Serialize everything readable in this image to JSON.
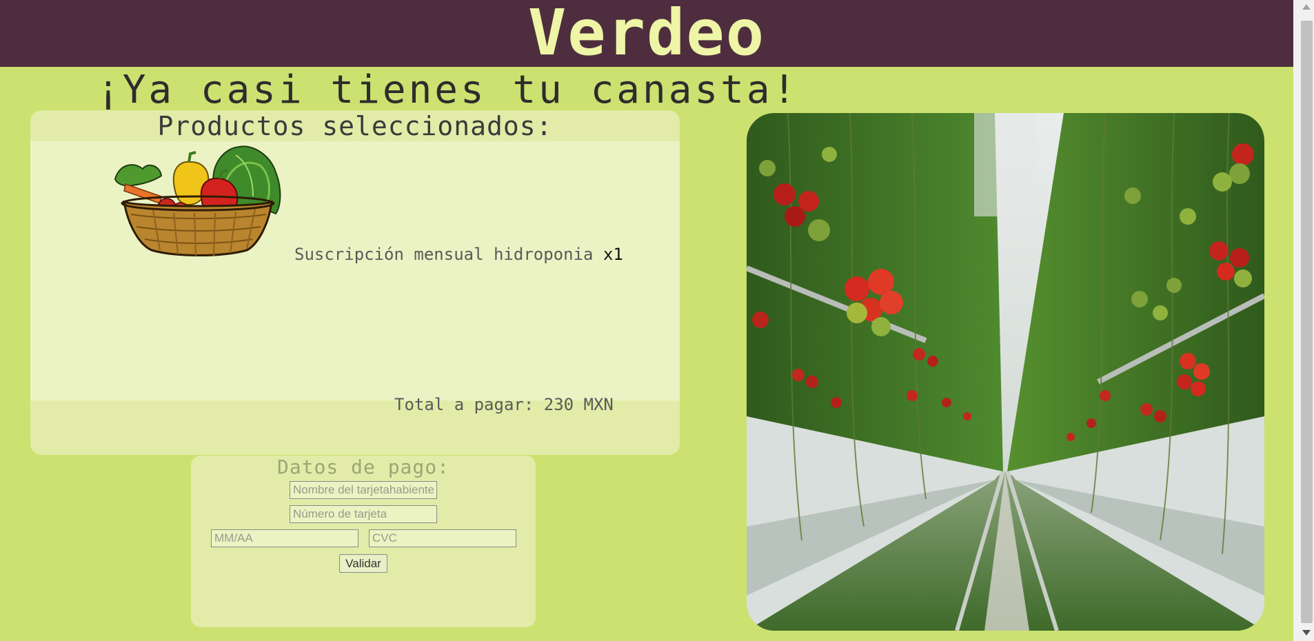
{
  "header": {
    "brand": "Verdeo"
  },
  "main": {
    "headline": "¡Ya casi tienes tu canasta!",
    "products": {
      "title": "Productos seleccionados:",
      "items": [
        {
          "name": "Suscripción mensual hidroponia",
          "quantity": "x1",
          "image_icon": "vegetable-basket-image"
        }
      ],
      "total": "Total a pagar: 230 MXN"
    },
    "payment": {
      "title": "Datos de pago:",
      "cardholder_placeholder": "Nombre del tarjetahabiente",
      "card_number_placeholder": "Número de tarjeta",
      "expiry_placeholder": "MM/AA",
      "cvc_placeholder": "CVC",
      "submit_label": "Validar"
    },
    "hero_image_icon": "greenhouse-tomatoes-photo"
  },
  "colors": {
    "background": "#cce170",
    "header": "#4e2e3e",
    "brand_text": "#eef5a6",
    "panel": "#e2eca8",
    "panel_inner": "#ebf3c4"
  }
}
